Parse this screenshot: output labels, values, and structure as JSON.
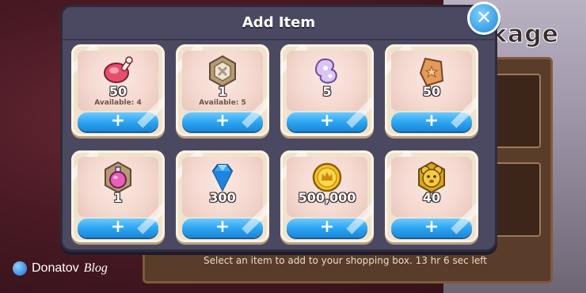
{
  "background": {
    "title_partial": "kage",
    "footer_text": "Select an item to add to your shopping box. 13 hr 6 sec left"
  },
  "watermark": {
    "name": "Donatov",
    "suffix": "Blog"
  },
  "modal": {
    "title": "Add Item",
    "close_label": "✕",
    "add_label": "+",
    "items": [
      {
        "icon": "meat-icon",
        "quantity": "50",
        "available": "Available: 4"
      },
      {
        "icon": "medal-icon",
        "quantity": "1",
        "available": "Available: 5"
      },
      {
        "icon": "spirit-icon",
        "quantity": "5",
        "available": ""
      },
      {
        "icon": "star-shard-icon",
        "quantity": "50",
        "available": ""
      },
      {
        "icon": "potion-icon",
        "quantity": "1",
        "available": ""
      },
      {
        "icon": "crystal-icon",
        "quantity": "300",
        "available": ""
      },
      {
        "icon": "coin-icon",
        "quantity": "500,000",
        "available": ""
      },
      {
        "icon": "gold-bear-icon",
        "quantity": "40",
        "available": ""
      }
    ]
  },
  "colors": {
    "modal_bg": "#4b4962",
    "card_bg": "#efe3d0",
    "button_blue": "#2aa2f0",
    "close_blue": "#1e88d8"
  }
}
